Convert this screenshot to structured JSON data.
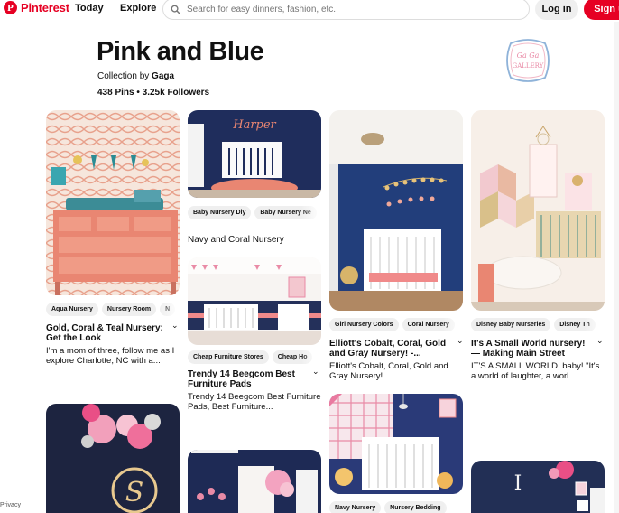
{
  "header": {
    "logo_text": "Pinterest",
    "nav_today": "Today",
    "nav_explore": "Explore",
    "search_placeholder": "Search for easy dinners, fashion, etc.",
    "login_label": "Log in",
    "signup_label": "Sign u"
  },
  "collection": {
    "title": "Pink and Blue",
    "byline_prefix": "Collection by",
    "owner": "Gaga",
    "stats": "438 Pins • 3.25k Followers",
    "logo_text_top": "Ga Ga",
    "logo_text_bottom": "GALLERY"
  },
  "pins": [
    {
      "tags": [
        "Aqua Nursery",
        "Nursery Room",
        "N"
      ],
      "title": "Gold, Coral & Teal Nursery: Get the Look",
      "description": "I'm a mom of three, follow me as I explore Charlotte, NC with a..."
    },
    {
      "image_text": "Harper",
      "tags": [
        "Baby Nursery Diy",
        "Baby Nursery Ne"
      ],
      "title": "Navy and Coral Nursery"
    },
    {
      "tags": [
        "Cheap Furniture Stores",
        "Cheap Ho"
      ],
      "title": "Trendy 14 Beegcom Best Furniture Pads",
      "description": "Trendy 14 Beegcom Best Furniture Pads, Best Furniture..."
    },
    {
      "tags": [
        "Girl Nursery Colors",
        "Coral Nursery"
      ],
      "title": "Elliott's Cobalt, Coral, Gold and Gray Nursery! -...",
      "description": "Elliott's Cobalt, Coral, Gold and Gray Nursery!"
    },
    {
      "tags": [
        "Disney Baby Nurseries",
        "Disney Th"
      ],
      "title": "It's A Small World nursery! — Making Main Street",
      "description": "IT'S A SMALL WORLD, baby! \"It's a world of laughter, a worl..."
    },
    {
      "tags": [
        "Navy Nursery",
        "Nursery Bedding"
      ]
    },
    {
      "image_text": "S"
    },
    {
      "image_text": "I"
    }
  ],
  "footer": {
    "privacy": "Privacy"
  },
  "colors": {
    "brand": "#e60023",
    "navy": "#1c2a4f",
    "coral": "#e98672"
  }
}
